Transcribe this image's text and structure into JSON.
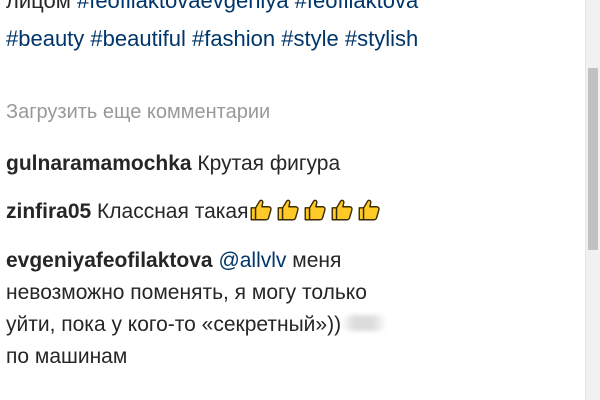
{
  "caption": {
    "line1_text": "лицом",
    "line1_hashtags": [
      "#feofilaktovaevgeniya",
      "#feofilaktova"
    ],
    "line2_hashtags": [
      "#beauty",
      "#beautiful",
      "#fashion",
      "#style",
      "#stylish"
    ]
  },
  "load_more_label": "Загрузить еще комментарии",
  "comments": [
    {
      "username": "gulnaramamochka",
      "text": "Крутая фигура"
    },
    {
      "username": "zinfira05",
      "text": "Классная такая",
      "emoji": "thumbs-up-icon",
      "emoji_count": 5
    },
    {
      "username": "evgeniyafeofilaktova",
      "mention": "@allvlv",
      "text_line1": "меня",
      "text_line2": "невозможно поменять, я могу только",
      "text_line3": "уйти, пока у кого-то «секретный»))",
      "text_line4": "по машинам"
    }
  ],
  "colors": {
    "text": "#262626",
    "hashtag": "#003569",
    "muted": "#999999",
    "thumb_fill": "#FFCA28",
    "thumb_stroke": "#3a2a00"
  }
}
